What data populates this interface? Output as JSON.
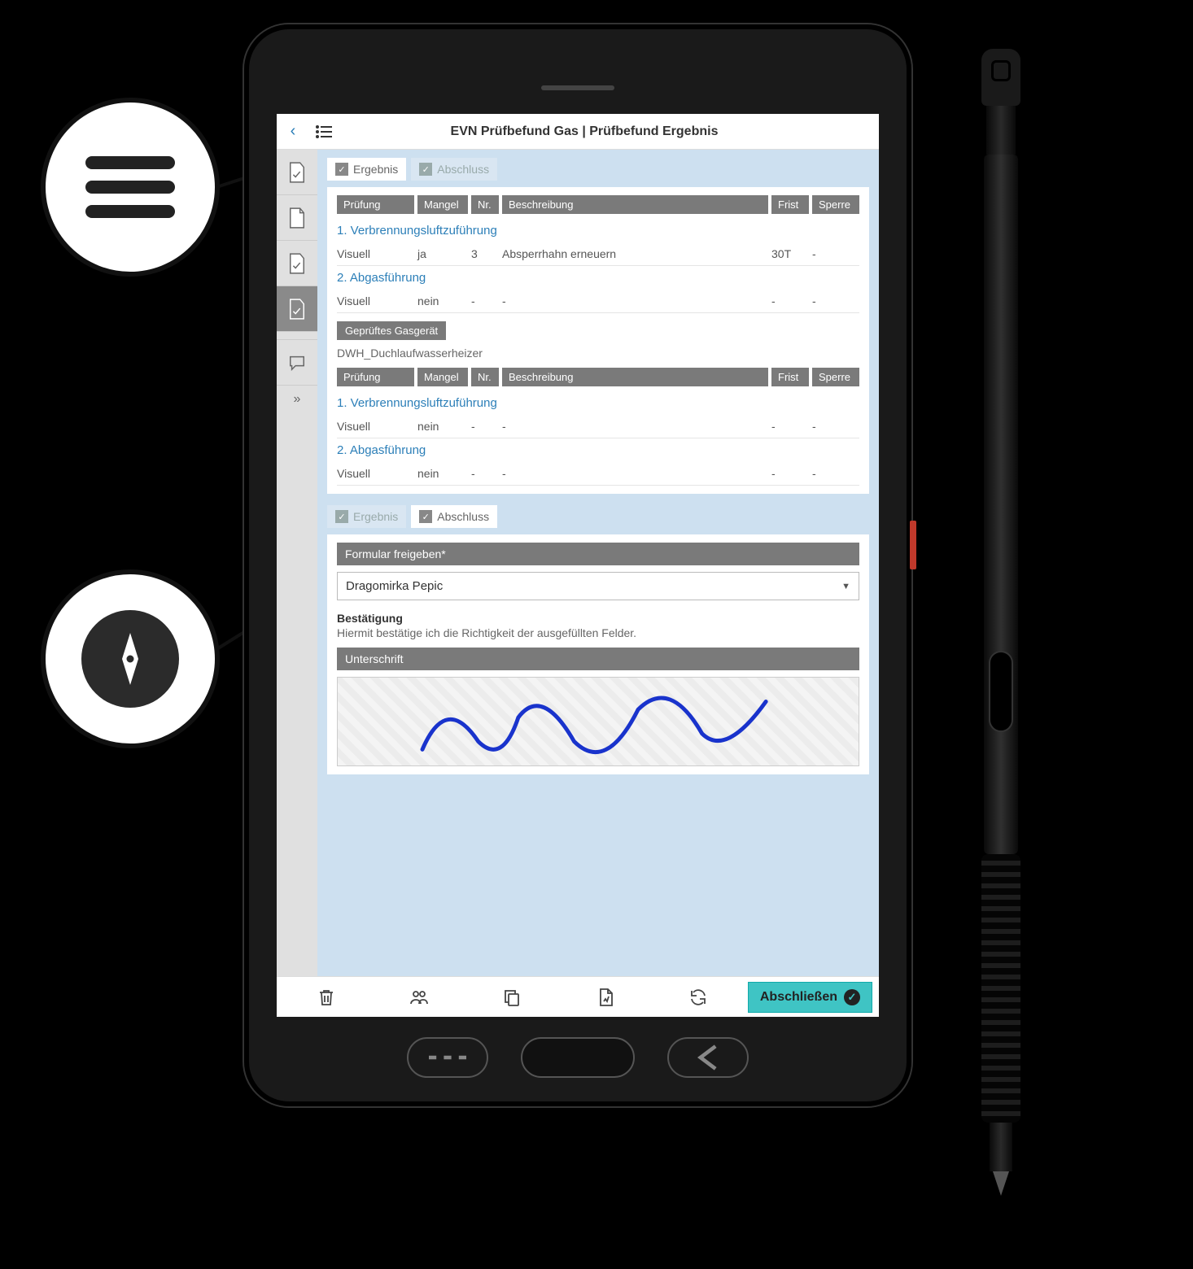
{
  "header": {
    "title": "EVN Prüfbefund Gas | Prüfbefund Ergebnis"
  },
  "tabs": {
    "ergebnis": "Ergebnis",
    "abschluss": "Abschluss"
  },
  "columns": {
    "pruefung": "Prüfung",
    "mangel": "Mangel",
    "nr": "Nr.",
    "beschreibung": "Beschreibung",
    "frist": "Frist",
    "sperre": "Sperre"
  },
  "group1": {
    "section1": {
      "title": "1. Verbrennungsluftzuführung",
      "pruefung": "Visuell",
      "mangel": "ja",
      "nr": "3",
      "beschreibung": "Absperrhahn erneuern",
      "frist": "30T",
      "sperre": "-"
    },
    "section2": {
      "title": "2. Abgasführung",
      "pruefung": "Visuell",
      "mangel": "nein",
      "nr": "-",
      "beschreibung": "-",
      "frist": "-",
      "sperre": "-"
    }
  },
  "device": {
    "label": "Geprüftes Gasgerät",
    "value": "DWH_Duchlaufwasserheizer"
  },
  "group2": {
    "section1": {
      "title": "1. Verbrennungsluftzuführung",
      "pruefung": "Visuell",
      "mangel": "nein",
      "nr": "-",
      "beschreibung": "-",
      "frist": "-",
      "sperre": "-"
    },
    "section2": {
      "title": "2. Abgasführung",
      "pruefung": "Visuell",
      "mangel": "nein",
      "nr": "-",
      "beschreibung": "-",
      "frist": "-",
      "sperre": "-"
    }
  },
  "abschluss": {
    "form_label": "Formular freigeben*",
    "select_value": "Dragomirka Pepic",
    "confirm_title": "Bestätigung",
    "confirm_text": "Hiermit bestätige ich die Richtigkeit der ausgefüllten Felder.",
    "signature_label": "Unterschrift"
  },
  "footer": {
    "finish": "Abschließen"
  }
}
